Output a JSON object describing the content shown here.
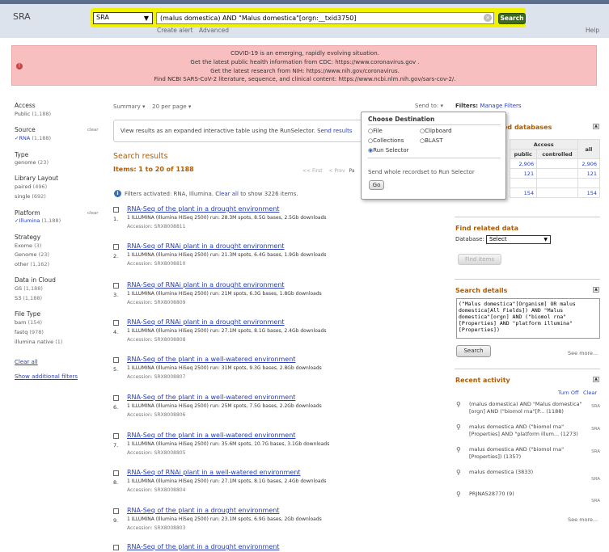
{
  "header": {
    "db_name": "SRA",
    "db_selected": "SRA",
    "search_value": "(malus domestica) AND \"Malus domestica\"[orgn:__txid3750]",
    "search_button": "Search",
    "create_alert": "Create alert",
    "advanced": "Advanced",
    "help": "Help"
  },
  "banner": {
    "lines": [
      "COVID-19 is an emerging, rapidly evolving situation.",
      "Get the latest public health information from CDC: https://www.coronavirus.gov .",
      "Get the latest research from NIH: https://www.nih.gov/coronavirus.",
      "Find NCBI SARS-CoV-2 literature, sequence, and clinical content: https://www.ncbi.nlm.nih.gov/sars-cov-2/."
    ]
  },
  "sidebar": {
    "access": {
      "heading": "Access",
      "items": [
        {
          "label": "Public",
          "count": "(1,188)"
        }
      ]
    },
    "source": {
      "heading": "Source",
      "clear": "clear",
      "items": [
        {
          "label": "RNA",
          "count": "(1,188)"
        }
      ]
    },
    "type": {
      "heading": "Type",
      "items": [
        {
          "label": "genome",
          "count": "(23)"
        }
      ]
    },
    "library_layout": {
      "heading": "Library Layout",
      "items": [
        {
          "label": "paired",
          "count": "(496)"
        },
        {
          "label": "single",
          "count": "(692)"
        }
      ]
    },
    "platform": {
      "heading": "Platform",
      "clear": "clear",
      "items": [
        {
          "label": "Illumina",
          "count": "(1,188)"
        }
      ]
    },
    "strategy": {
      "heading": "Strategy",
      "items": [
        {
          "label": "Exome",
          "count": "(3)"
        },
        {
          "label": "Genome",
          "count": "(23)"
        },
        {
          "label": "other",
          "count": "(1,162)"
        }
      ]
    },
    "cloud": {
      "heading": "Data in Cloud",
      "items": [
        {
          "label": "GS",
          "count": "(1,188)"
        },
        {
          "label": "S3",
          "count": "(1,188)"
        }
      ]
    },
    "file_type": {
      "heading": "File Type",
      "items": [
        {
          "label": "bam",
          "count": "(154)"
        },
        {
          "label": "fastq",
          "count": "(978)"
        },
        {
          "label": "illumina native",
          "count": "(1)"
        }
      ]
    },
    "clear_all": "Clear all",
    "show_additional": "Show additional filters"
  },
  "main": {
    "summary": "Summary",
    "per_page": "20 per page",
    "send_to": "Send to:",
    "runselector_text": "View results as an expanded interactive table using the RunSelector.",
    "runselector_link": "Send results",
    "search_results": "Search results",
    "items_line": "Items: 1 to 20 of 1188",
    "first": "<< First",
    "prev": "< Prev",
    "page": "Pa",
    "filters_text": "Filters activated: RNA, Illumina.",
    "clear_all_link": "Clear all",
    "filters_suffix": "to show 3226 items.",
    "results": [
      {
        "num": "1.",
        "title": "RNA-Seq of the plant in a drought environment",
        "desc": "1 ILLUMINA (Illumina HiSeq 2500) run: 28.3M spots, 8.5G bases, 2.5Gb downloads",
        "acc": "Accession: SRX8008811"
      },
      {
        "num": "2.",
        "title": "RNA-Seq of RNAi plant in a drought environment",
        "desc": "1 ILLUMINA (Illumina HiSeq 2500) run: 21.3M spots, 6.4G bases, 1.9Gb downloads",
        "acc": "Accession: SRX8008810"
      },
      {
        "num": "3.",
        "title": "RNA-Seq of RNAi plant in a drought environment",
        "desc": "1 ILLUMINA (Illumina HiSeq 2500) run: 21M spots, 6.3G bases, 1.8Gb downloads",
        "acc": "Accession: SRX8008809"
      },
      {
        "num": "4.",
        "title": "RNA-Seq of RNAi plant in a drought environment",
        "desc": "1 ILLUMINA (Illumina HiSeq 2500) run: 27.1M spots, 8.1G bases, 2.4Gb downloads",
        "acc": "Accession: SRX8008808"
      },
      {
        "num": "5.",
        "title": "RNA-Seq of the plant in a well-watered environment",
        "desc": "1 ILLUMINA (Illumina HiSeq 2500) run: 31M spots, 9.3G bases, 2.8Gb downloads",
        "acc": "Accession: SRX8008807"
      },
      {
        "num": "6.",
        "title": "RNA-Seq of the plant in a well-watered environment",
        "desc": "1 ILLUMINA (Illumina HiSeq 2500) run: 25M spots, 7.5G bases, 2.2Gb downloads",
        "acc": "Accession: SRX8008806"
      },
      {
        "num": "7.",
        "title": "RNA-Seq of the plant in a well-watered environment",
        "desc": "1 ILLUMINA (Illumina HiSeq 2500) run: 35.6M spots, 10.7G bases, 3.1Gb downloads",
        "acc": "Accession: SRX8008805"
      },
      {
        "num": "8.",
        "title": "RNA-Seq of RNAi plant in a well-watered environment",
        "desc": "1 ILLUMINA (Illumina HiSeq 2500) run: 27.1M spots, 8.1G bases, 2.4Gb downloads",
        "acc": "Accession: SRX8008804"
      },
      {
        "num": "9.",
        "title": "RNA-Seq of the plant in a drought environment",
        "desc": "1 ILLUMINA (Illumina HiSeq 2500) run: 23.1M spots, 6.9G bases, 2Gb downloads",
        "acc": "Accession: SRX8008803"
      },
      {
        "num": "",
        "title": "RNA-Seq of the plant in a drought environment",
        "desc": "",
        "acc": ""
      }
    ]
  },
  "popup": {
    "title": "Choose Destination",
    "options": [
      "File",
      "Clipboard",
      "Collections",
      "BLAST",
      "Run Selector"
    ],
    "selected": "Run Selector",
    "note": "Send whole recordset to Run Selector",
    "go": "Go"
  },
  "right": {
    "filters_label": "Filters:",
    "manage_filters": "Manage Filters",
    "linked_title": "ed databases",
    "access_head": "Access",
    "public_head": "public",
    "controlled_head": "controlled",
    "all_head": "all",
    "linked_rows": [
      [
        "2,906",
        "2,906"
      ],
      [
        "121",
        "121"
      ],
      [
        "",
        ""
      ],
      [
        "154",
        "154"
      ]
    ],
    "find_related": "Find related data",
    "database_label": "Database:",
    "database_select": "Select",
    "find_items": "Find items",
    "search_details": "Search details",
    "details_text": "(\"Malus domestica\"[Organism] OR malus domestica[All Fields]) AND \"Malus domestica\"[orgn] AND (\"biomol rna\"[Properties] AND \"platform illumina\"[Properties])",
    "search_btn": "Search",
    "see_more": "See more...",
    "recent_activity": "Recent activity",
    "turn_off": "Turn Off",
    "clear": "Clear",
    "recent": [
      {
        "text": "(malus domestica) AND \"Malus domestica\"[orgn] AND (\"biomol rna\"[P... (1188)",
        "db": "SRA"
      },
      {
        "text": "malus domestica AND (\"biomol rna\"[Properties] AND \"platform illum... (1273)",
        "db": "SRA"
      },
      {
        "text": "malus domestica AND (\"biomol rna\"[Properties]) (1357)",
        "db": "SRA"
      },
      {
        "text": "malus domestica (3833)",
        "db": "SRA"
      },
      {
        "text": "PRJNA528770 (9)",
        "db": "SRA"
      }
    ],
    "see_more2": "See more..."
  }
}
